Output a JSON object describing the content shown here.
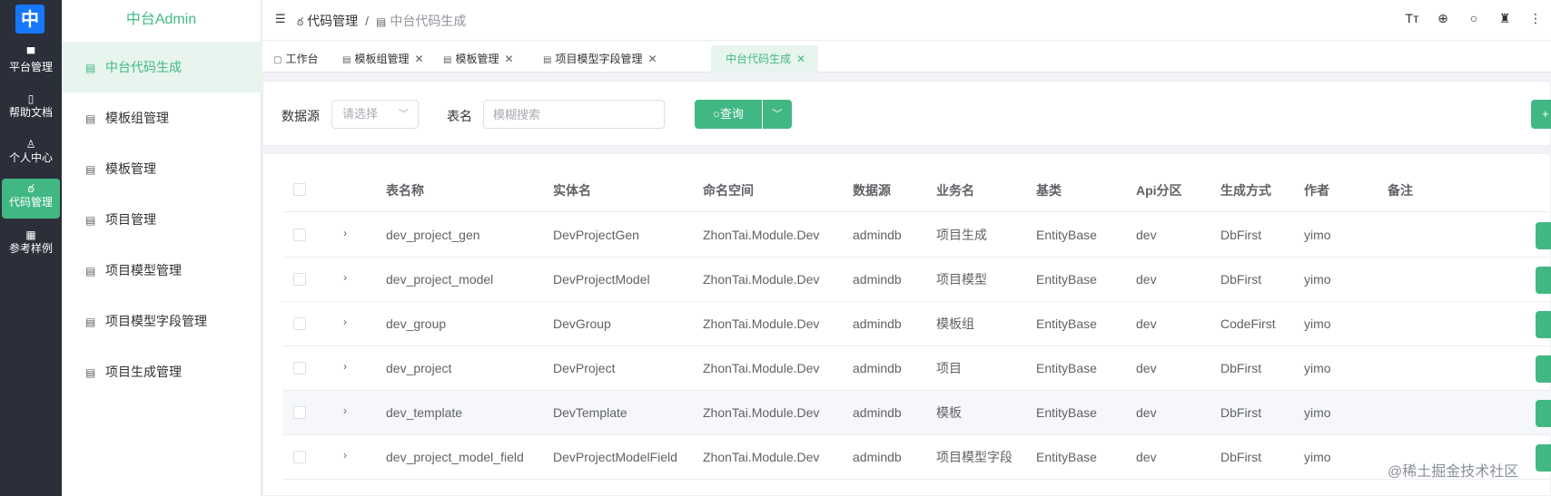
{
  "rail": {
    "logo_text": "中",
    "items": [
      {
        "label": "平台管理",
        "icon": "monitor-icon",
        "glyph": "▀"
      },
      {
        "label": "帮助文档",
        "icon": "book-icon",
        "glyph": "▯"
      },
      {
        "label": "个人中心",
        "icon": "user-icon",
        "glyph": "♙"
      },
      {
        "label": "代码管理",
        "icon": "code-icon",
        "glyph": "ఠ"
      },
      {
        "label": "参考样例",
        "icon": "grid-icon",
        "glyph": "▦"
      }
    ]
  },
  "submenu": {
    "brand": "中台Admin",
    "items": [
      {
        "label": "中台代码生成"
      },
      {
        "label": "模板组管理"
      },
      {
        "label": "模板管理"
      },
      {
        "label": "项目管理"
      },
      {
        "label": "项目模型管理"
      },
      {
        "label": "项目模型字段管理"
      },
      {
        "label": "项目生成管理"
      }
    ]
  },
  "header": {
    "breadcrumb": [
      "代码管理",
      "中台代码生成"
    ],
    "separator": "/",
    "icons": [
      "font-size-icon",
      "language-icon",
      "search-icon",
      "skin-icon",
      "more-icon"
    ]
  },
  "tabs": [
    {
      "label": "工作台",
      "closable": false
    },
    {
      "label": "模板组管理",
      "closable": true
    },
    {
      "label": "模板管理",
      "closable": true
    },
    {
      "label": "项目模型字段管理",
      "closable": true
    },
    {
      "label": "中台代码生成",
      "closable": true,
      "active": true
    }
  ],
  "search": {
    "datasource_label": "数据源",
    "datasource_placeholder": "请选择",
    "table_label": "表名",
    "table_placeholder": "模糊搜索",
    "query_label": "查询",
    "add_label": "+"
  },
  "table": {
    "columns": [
      "表名称",
      "实体名",
      "命名空间",
      "数据源",
      "业务名",
      "基类",
      "Api分区",
      "生成方式",
      "作者",
      "备注"
    ],
    "rows": [
      [
        "dev_project_gen",
        "DevProjectGen",
        "ZhonTai.Module.Dev",
        "admindb",
        "项目生成",
        "EntityBase",
        "dev",
        "DbFirst",
        "yimo",
        ""
      ],
      [
        "dev_project_model",
        "DevProjectModel",
        "ZhonTai.Module.Dev",
        "admindb",
        "项目模型",
        "EntityBase",
        "dev",
        "DbFirst",
        "yimo",
        ""
      ],
      [
        "dev_group",
        "DevGroup",
        "ZhonTai.Module.Dev",
        "admindb",
        "模板组",
        "EntityBase",
        "dev",
        "CodeFirst",
        "yimo",
        ""
      ],
      [
        "dev_project",
        "DevProject",
        "ZhonTai.Module.Dev",
        "admindb",
        "项目",
        "EntityBase",
        "dev",
        "DbFirst",
        "yimo",
        ""
      ],
      [
        "dev_template",
        "DevTemplate",
        "ZhonTai.Module.Dev",
        "admindb",
        "模板",
        "EntityBase",
        "dev",
        "DbFirst",
        "yimo",
        ""
      ],
      [
        "dev_project_model_field",
        "DevProjectModelField",
        "ZhonTai.Module.Dev",
        "admindb",
        "项目模型字段",
        "EntityBase",
        "dev",
        "DbFirst",
        "yimo",
        ""
      ]
    ]
  },
  "watermark": "@稀土掘金技术社区",
  "colors": {
    "accent": "#41b883",
    "rail_bg": "#2b2f3a",
    "logo_bg": "#1677ff"
  }
}
